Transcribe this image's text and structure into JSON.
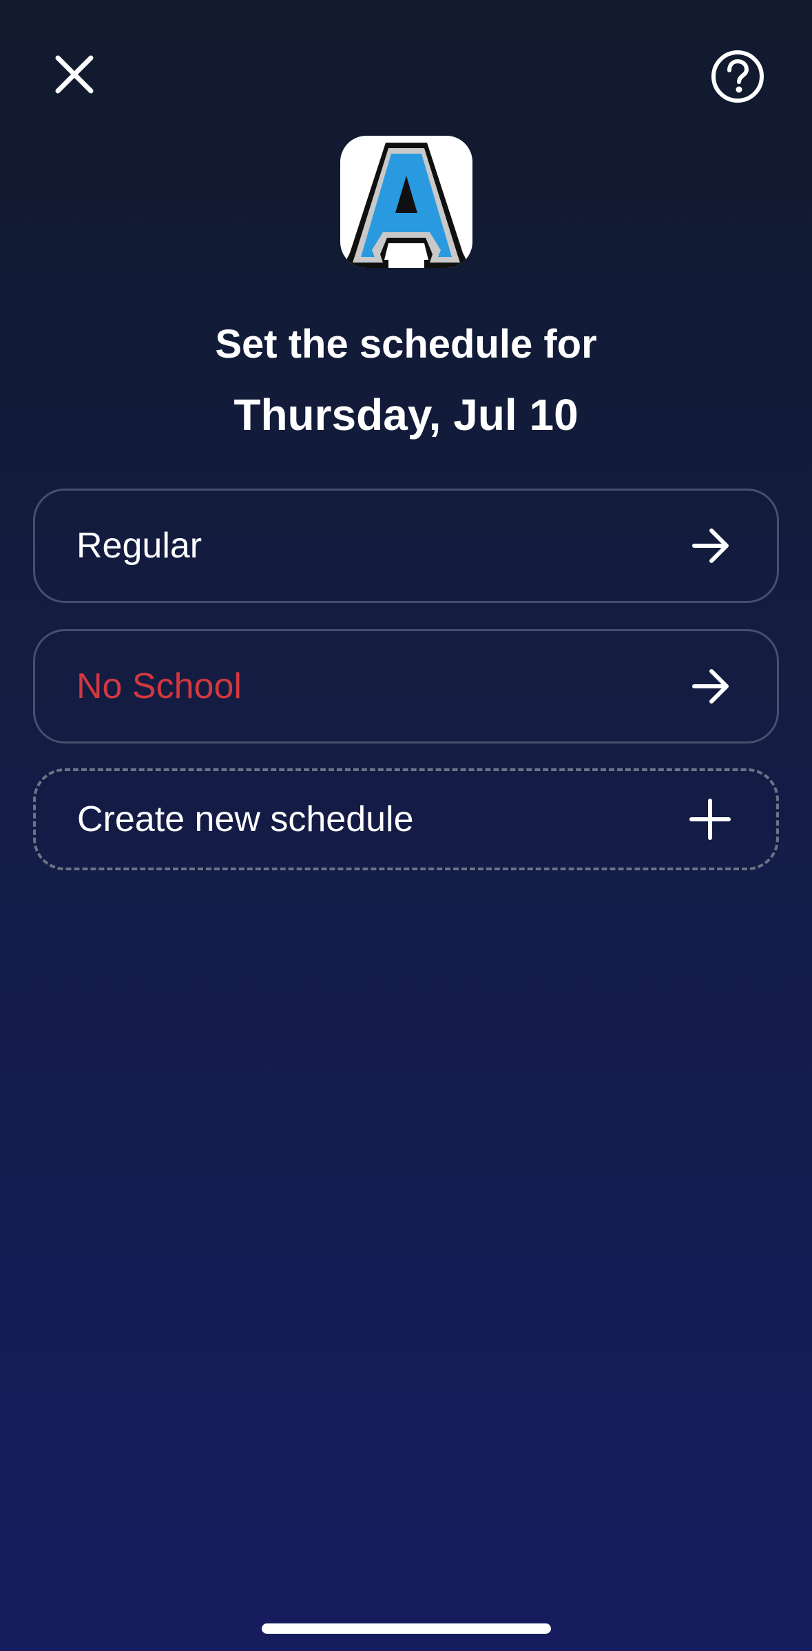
{
  "header": {
    "close_icon": "close-icon",
    "help_icon": "question-circle-icon"
  },
  "logo": {
    "letter": "A",
    "letter_color": "#2a9ae0"
  },
  "heading": {
    "line1": "Set the schedule for",
    "line2": "Thursday, Jul 10"
  },
  "options": [
    {
      "label": "Regular",
      "icon": "arrow-right-icon",
      "color": "#ffffff"
    },
    {
      "label": "No School",
      "icon": "arrow-right-icon",
      "color": "#d2383f"
    },
    {
      "label": "Create new schedule",
      "icon": "plus-icon",
      "color": "#ffffff"
    }
  ],
  "colors": {
    "background_top": "#111a2c",
    "background_bottom": "#161c5e",
    "card_border": "#46506e",
    "dashed_border": "#6b7387",
    "danger": "#d2383f"
  }
}
